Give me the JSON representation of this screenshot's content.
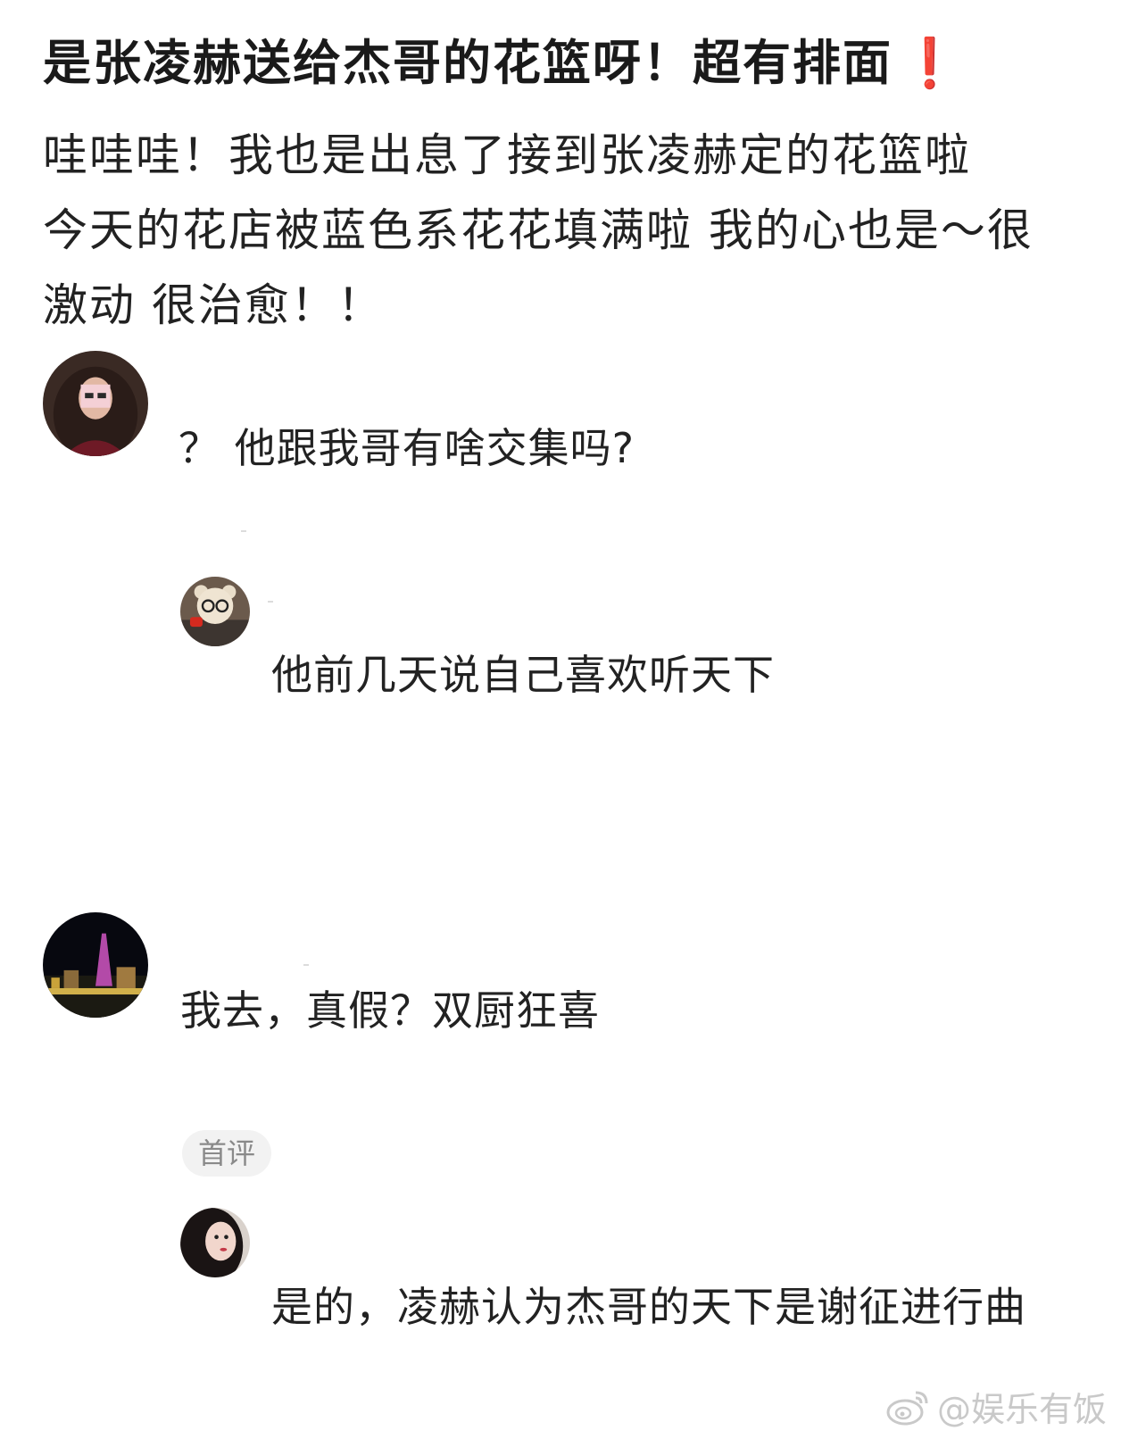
{
  "post": {
    "title": "是张凌赫送给杰哥的花篮呀！超有排面",
    "title_emoji": "❗",
    "body_lines": [
      "哇哇哇！我也是出息了接到张凌赫定的花篮啦",
      "今天的花店被蓝色系花花填满啦 我的心也是～很",
      "激动 很治愈！！"
    ]
  },
  "comments": [
    {
      "text": "？ 他跟我哥有啥交集吗?"
    },
    {
      "text": "他前几天说自己喜欢听天下"
    },
    {
      "text": "我去，真假？双厨狂喜"
    },
    {
      "badge": "首评",
      "text": "是的，凌赫认为杰哥的天下是谢征进行曲"
    }
  ],
  "watermark": "@娱乐有饭",
  "colors": {
    "title_emoji": "#e02020",
    "badge_bg": "#f2f2f2",
    "badge_text": "#8a8a8a",
    "watermark": "#c9c9c9"
  }
}
